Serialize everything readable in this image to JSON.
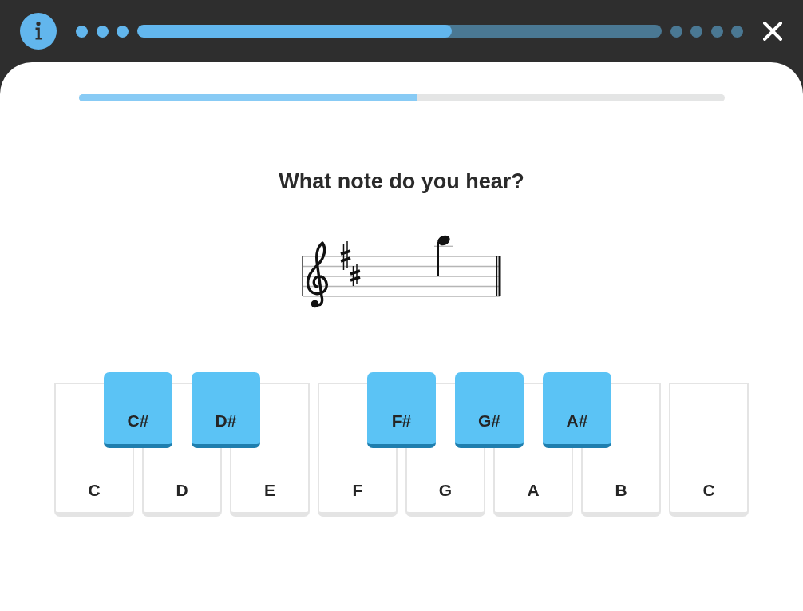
{
  "header": {
    "steps": [
      {
        "kind": "dot",
        "done": true
      },
      {
        "kind": "dot",
        "done": true
      },
      {
        "kind": "dot",
        "done": true
      },
      {
        "kind": "bar",
        "level": 0.6
      },
      {
        "kind": "dot",
        "done": false
      },
      {
        "kind": "dot",
        "done": false
      },
      {
        "kind": "dot",
        "done": false
      },
      {
        "kind": "dot",
        "done": false
      }
    ]
  },
  "progress": {
    "level": 0.523
  },
  "question": "What note do you hear?",
  "keyboard": {
    "keys": [
      {
        "label": "C",
        "sharp": {
          "label": "C#"
        }
      },
      {
        "label": "D",
        "sharp": {
          "label": "D#"
        }
      },
      {
        "label": "E"
      },
      {
        "label": "F",
        "sharp": {
          "label": "F#"
        }
      },
      {
        "label": "G",
        "sharp": {
          "label": "G#"
        }
      },
      {
        "label": "A",
        "sharp": {
          "label": "A#"
        }
      },
      {
        "label": "B"
      },
      {
        "label": "C"
      }
    ]
  }
}
